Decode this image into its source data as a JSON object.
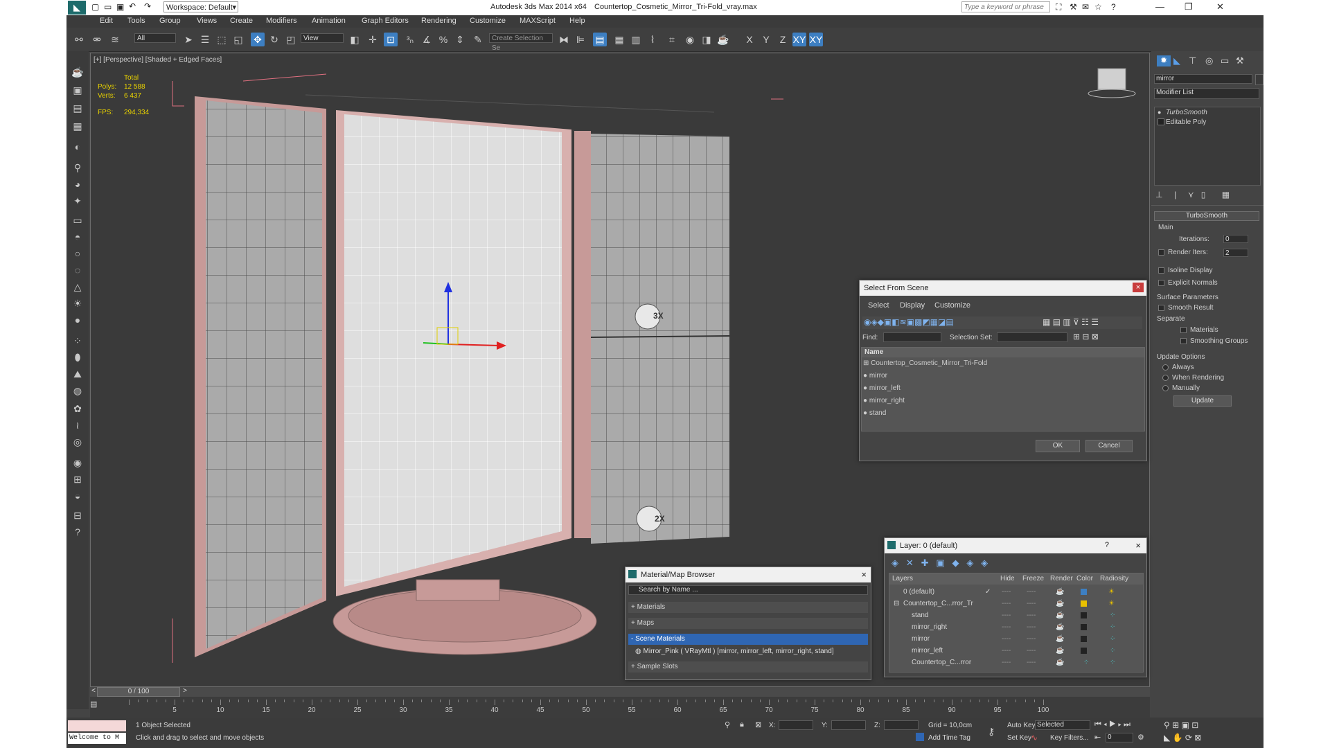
{
  "titlebar": {
    "workspace": "Workspace: Default",
    "app_title": "Autodesk 3ds Max  2014 x64",
    "file_name": "Countertop_Cosmetic_Mirror_Tri-Fold_vray.max",
    "search_placeholder": "Type a keyword or phrase"
  },
  "menu": [
    "Edit",
    "Tools",
    "Group",
    "Views",
    "Create",
    "Modifiers",
    "Animation",
    "Graph Editors",
    "Rendering",
    "Customize",
    "MAXScript",
    "Help"
  ],
  "toolbar": {
    "filter_value": "All",
    "view_value": "View",
    "selection_set_placeholder": "Create Selection Se",
    "axis_x": "X",
    "axis_y": "Y",
    "axis_z": "Z",
    "axis_xy": "XY",
    "axis_xy2": "XY"
  },
  "viewport": {
    "label": "[+] [Perspective] [Shaded + Edged Faces]",
    "stats": {
      "total_label": "Total",
      "polys_label": "Polys:",
      "polys": "12 588",
      "verts_label": "Verts:",
      "verts": "6 437",
      "fps_label": "FPS:",
      "fps": "294,334"
    },
    "marker_3x": "3X",
    "marker_2x": "2X"
  },
  "command_panel": {
    "object_name": "mirror",
    "modifier_list": "Modifier List",
    "stack": [
      "TurboSmooth",
      "Editable Poly"
    ],
    "rollout_title": "TurboSmooth",
    "main_label": "Main",
    "iterations_label": "Iterations:",
    "iterations": "0",
    "render_iters_label": "Render Iters:",
    "render_iters": "2",
    "isoline": "Isoline Display",
    "explicit": "Explicit Normals",
    "surface_params": "Surface Parameters",
    "smooth_result": "Smooth Result",
    "separate": "Separate",
    "materials": "Materials",
    "smoothing_groups": "Smoothing Groups",
    "update_options": "Update Options",
    "always": "Always",
    "when_rendering": "When Rendering",
    "manually": "Manually",
    "update_btn": "Update"
  },
  "select_dialog": {
    "title": "Select From Scene",
    "close": "×",
    "tabs": [
      "Select",
      "Display",
      "Customize"
    ],
    "find_label": "Find:",
    "selection_set_label": "Selection Set:",
    "column_name": "Name",
    "rows": [
      "Countertop_Cosmetic_Mirror_Tri-Fold",
      "mirror",
      "mirror_left",
      "mirror_right",
      "stand"
    ],
    "ok": "OK",
    "cancel": "Cancel"
  },
  "material_browser": {
    "title": "Material/Map Browser",
    "close": "×",
    "search_placeholder": "Search by Name ...",
    "sections": [
      "+ Materials",
      "+ Maps",
      "- Scene Materials"
    ],
    "material_item": "Mirror_Pink  ( VRayMtl )  [mirror, mirror_left, mirror_right, stand]",
    "sample_slots": "+ Sample Slots"
  },
  "layer_dialog": {
    "title": "Layer: 0 (default)",
    "help": "?",
    "close": "×",
    "columns": [
      "Layers",
      "Hide",
      "Freeze",
      "Render",
      "Color",
      "Radiosity"
    ],
    "rows": [
      {
        "name": "0 (default)",
        "dash1": "----",
        "dash2": "----"
      },
      {
        "name": "Countertop_C...rror_Tr",
        "dash1": "----",
        "dash2": "----"
      },
      {
        "name": "stand",
        "dash1": "----",
        "dash2": "----"
      },
      {
        "name": "mirror_right",
        "dash1": "----",
        "dash2": "----"
      },
      {
        "name": "mirror",
        "dash1": "----",
        "dash2": "----"
      },
      {
        "name": "mirror_left",
        "dash1": "----",
        "dash2": "----"
      },
      {
        "name": "Countertop_C...rror",
        "dash1": "----",
        "dash2": "----"
      }
    ]
  },
  "timeline": {
    "frame_counter": "0 / 100",
    "ticks": [
      "5",
      "10",
      "15",
      "20",
      "25",
      "30",
      "35",
      "40",
      "45",
      "50",
      "55",
      "60",
      "65",
      "70",
      "75",
      "80",
      "85",
      "90",
      "95",
      "100"
    ]
  },
  "statusbar": {
    "maxscript": "Welcome to M",
    "selected": "1 Object Selected",
    "prompt": "Click and drag to select and move objects",
    "x_label": "X:",
    "y_label": "Y:",
    "z_label": "Z:",
    "grid": "Grid = 10,0cm",
    "auto_key": "Auto Key",
    "selected_dropdown": "Selected",
    "set_key": "Set Key",
    "key_filters": "Key Filters...",
    "add_time_tag": "Add Time Tag",
    "frame": "0"
  }
}
